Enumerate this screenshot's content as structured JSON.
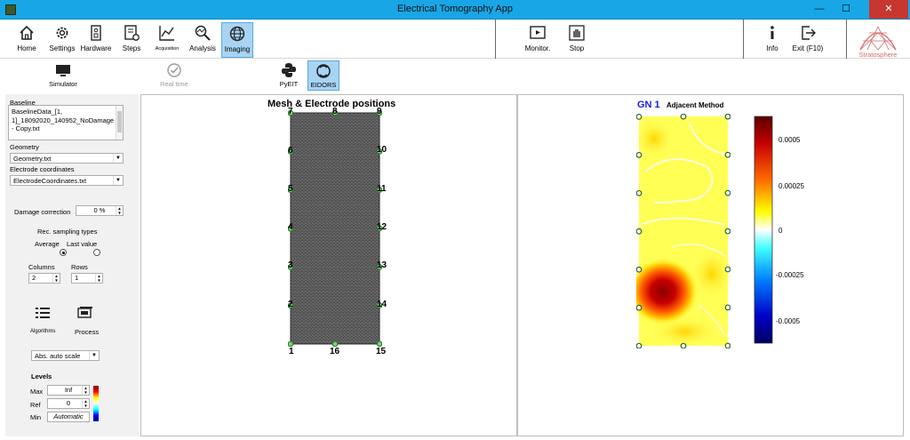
{
  "window": {
    "title": "Electrical Tomography App",
    "min": "—",
    "max": "☐",
    "close": "✕"
  },
  "toolbar": {
    "home": "Home",
    "settings": "Settings",
    "hardware": "Hardware",
    "steps": "Steps",
    "acquisition": "Acquisition",
    "analysis": "Analysis",
    "imaging": "Imaging",
    "monitor": "Monitor.",
    "stop": "Stop",
    "info": "Info",
    "exit": "Exit (F10)"
  },
  "brand": {
    "name": "Stratosphere"
  },
  "subtoolbar": {
    "simulator": "Simulator",
    "realtime": "Real time",
    "pyeit": "PyEIT",
    "eidors": "EIDORS"
  },
  "left": {
    "baseline_label": "Baseline",
    "baseline_value_l1": "BaselineData_[1,",
    "baseline_value_l2": "1]_18092020_140952_NoDamage",
    "baseline_value_l3": "- Copy.txt",
    "geometry_label": "Geometry",
    "geometry_value": "Geometry.txt",
    "electrode_label": "Electrode coordinates",
    "electrode_value": "ElectrodeCoordinates.txt",
    "damage_label": "Damage correction",
    "damage_value": "0 %",
    "rec_label": "Rec. sampling types",
    "average_label": "Average",
    "lastvalue_label": "Last value",
    "columns_label": "Columns",
    "rows_label": "Rows",
    "columns_value": "2",
    "rows_value": "1",
    "algorithms_label": "Algorithms",
    "process_label": "Process",
    "scale_value": "Abs. auto scale",
    "levels_label": "Levels",
    "max_label": "Max",
    "max_value": "Inf",
    "ref_label": "Ref",
    "ref_value": "0",
    "min_label": "Min",
    "min_value": "Automatic"
  },
  "mesh": {
    "title": "Mesh & Electrode positions",
    "labels": [
      "1",
      "2",
      "3",
      "4",
      "5",
      "6",
      "7",
      "8",
      "9",
      "10",
      "11",
      "12",
      "13",
      "14",
      "15",
      "16"
    ]
  },
  "recon": {
    "title_gn": "GN 1",
    "title_method": "Adjacent Method",
    "colorbar_ticks": [
      "0.0005",
      "0.00025",
      "0",
      "-0.00025",
      "-0.0005"
    ]
  },
  "colors": {
    "titlebar": "#19a6e6",
    "active": "#a8d4f4",
    "close": "#c7372f",
    "gn": "#1a1ae6"
  },
  "icons": {
    "home": "home-icon",
    "settings": "gear-icon",
    "hardware": "hardware-icon",
    "steps": "steps-icon",
    "acquisition": "chart-icon",
    "analysis": "analysis-icon",
    "imaging": "globe-icon",
    "monitor": "play-icon",
    "stop": "hand-icon",
    "info": "info-icon",
    "exit": "exit-icon"
  }
}
